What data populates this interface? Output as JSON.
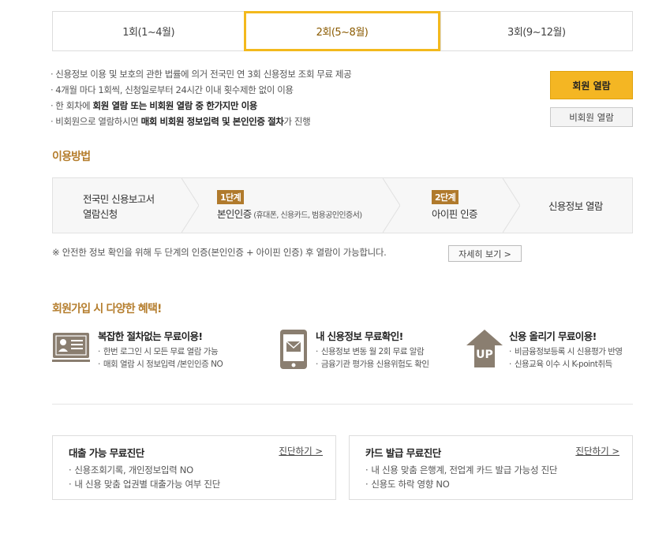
{
  "tabs": [
    {
      "label": "1회(1~4월)",
      "active": false
    },
    {
      "label": "2회(5~8월)",
      "active": true
    },
    {
      "label": "3회(9~12월)",
      "active": false
    }
  ],
  "info": {
    "line1": "신용정보 이용 및 보호의 관한 법률에 의거 전국민 연 3회 신용정보 조회 무료 제공",
    "line2": "4개월 마다 1회씩, 신청일로부터 24시간 이내 횟수제한 없이 이용",
    "line3_pre": "한 회차에 ",
    "line3_bold": "회원 열람 또는 비회원 열람 중 한가지만 이용",
    "line4_pre": "비회원으로 열람하시면 ",
    "line4_bold": "매회 비회원 정보입력 및 본인인증 절차",
    "line4_post": "가 진행"
  },
  "buttons": {
    "member": "회원 열람",
    "nonmember": "비회원 열람"
  },
  "usage": {
    "title": "이용방법",
    "step1_line1": "전국민 신용보고서",
    "step1_line2": "열람신청",
    "step2_badge": "1단계",
    "step2_label": "본인인증",
    "step2_sub": " (휴대폰, 신용카드, 범용공인인증서)",
    "step3_badge": "2단계",
    "step3_label": "아이핀 인증",
    "step4_label": "신용정보 열람",
    "notice": "※ 안전한 정보 확인을 위해 두 단계의 인증(본인인증 + 아이핀 인증) 후 열람이 가능합니다.",
    "detail_button": "자세히 보기 >"
  },
  "benefits": {
    "title": "회원가입 시 다양한 혜택!",
    "items": [
      {
        "title": "복잡한 절차없는 무료이용!",
        "lines": [
          "한번 로그인 시 모든 무료 열람 가능",
          "매회 열람 시 정보입력 /본인인증 NO"
        ],
        "icon": "id-card-icon"
      },
      {
        "title": "내 신용정보 무료확인!",
        "lines": [
          "신용정보 변동 월 2회 무료 알람",
          "금융기관 평가용 신용위험도 확인"
        ],
        "icon": "mobile-mail-icon"
      },
      {
        "title": "신용 올리기 무료이용!",
        "lines": [
          "비금융정보등록 시 신용평가 반영",
          "신용교육 이수 시 K-point취득"
        ],
        "icon": "up-arrow-icon",
        "icon_text": "UP"
      }
    ]
  },
  "diagnosis": [
    {
      "title": "대출 가능 무료진단",
      "link": "진단하기 >",
      "lines": [
        "신용조회기록, 개인정보입력 NO",
        "내 신용 맞춤 업권별 대출가능 여부 진단"
      ]
    },
    {
      "title": "카드 발급 무료진단",
      "link": "진단하기 >",
      "lines": [
        "내 신용 맞춤 은행계, 전업계 카드 발급 가능성 진단",
        "신용도 하락 영향 NO"
      ]
    }
  ],
  "colors": {
    "accent": "#f3b91d",
    "brown": "#b07a2c",
    "icon_gray": "#8a7e70"
  }
}
